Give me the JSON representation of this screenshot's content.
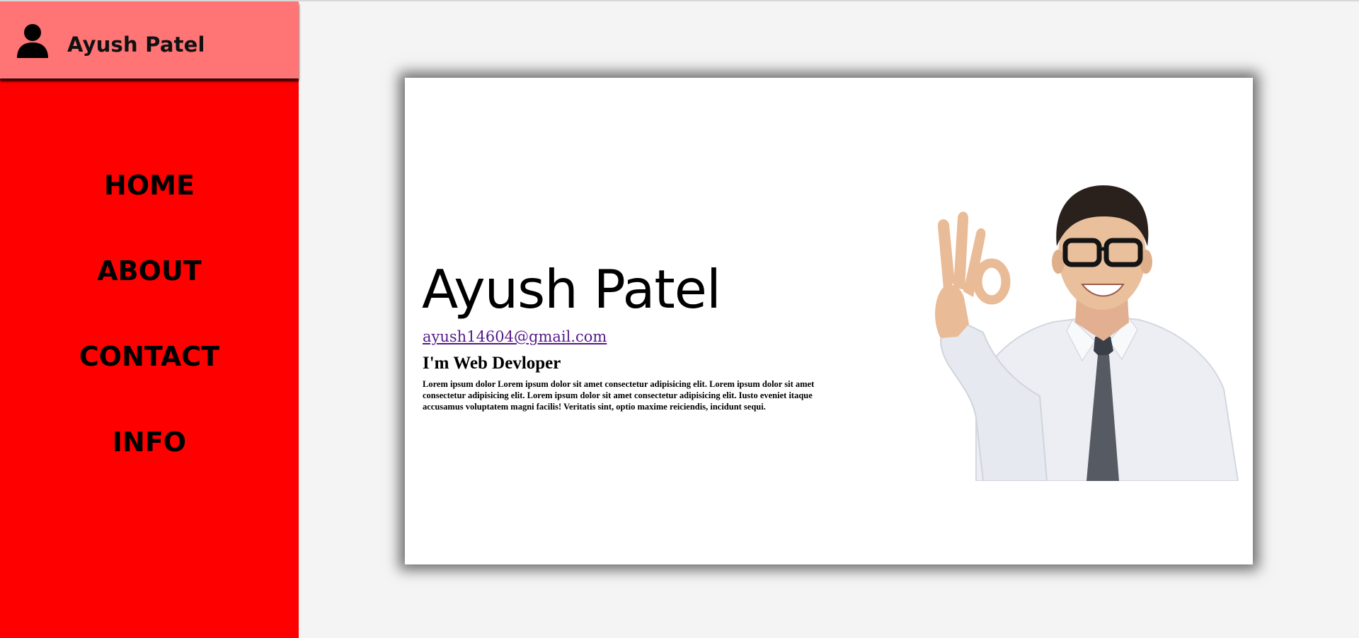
{
  "sidebar": {
    "user_name": "Ayush Patel",
    "user_icon": "user-icon",
    "items": [
      {
        "label": "HOME"
      },
      {
        "label": "ABOUT"
      },
      {
        "label": "CONTACT"
      },
      {
        "label": "INFO"
      }
    ]
  },
  "profile": {
    "name": "Ayush Patel",
    "email": "ayush14604@gmail.com",
    "role": "I'm Web Devloper",
    "bio": "Lorem ipsum dolor Lorem ipsum dolor sit amet consectetur adipisicing elit. Lorem ipsum dolor sit amet consectetur adipisicing elit. Lorem ipsum dolor sit amet consectetur adipisicing elit. Iusto eveniet itaque accusamus voluptatem magni facilis! Veritatis sint, optio maxime reiciendis, incidunt sequi."
  },
  "colors": {
    "sidebar_bg": "#ff0000",
    "header_bg": "#ff7474",
    "link": "#551a8b"
  }
}
